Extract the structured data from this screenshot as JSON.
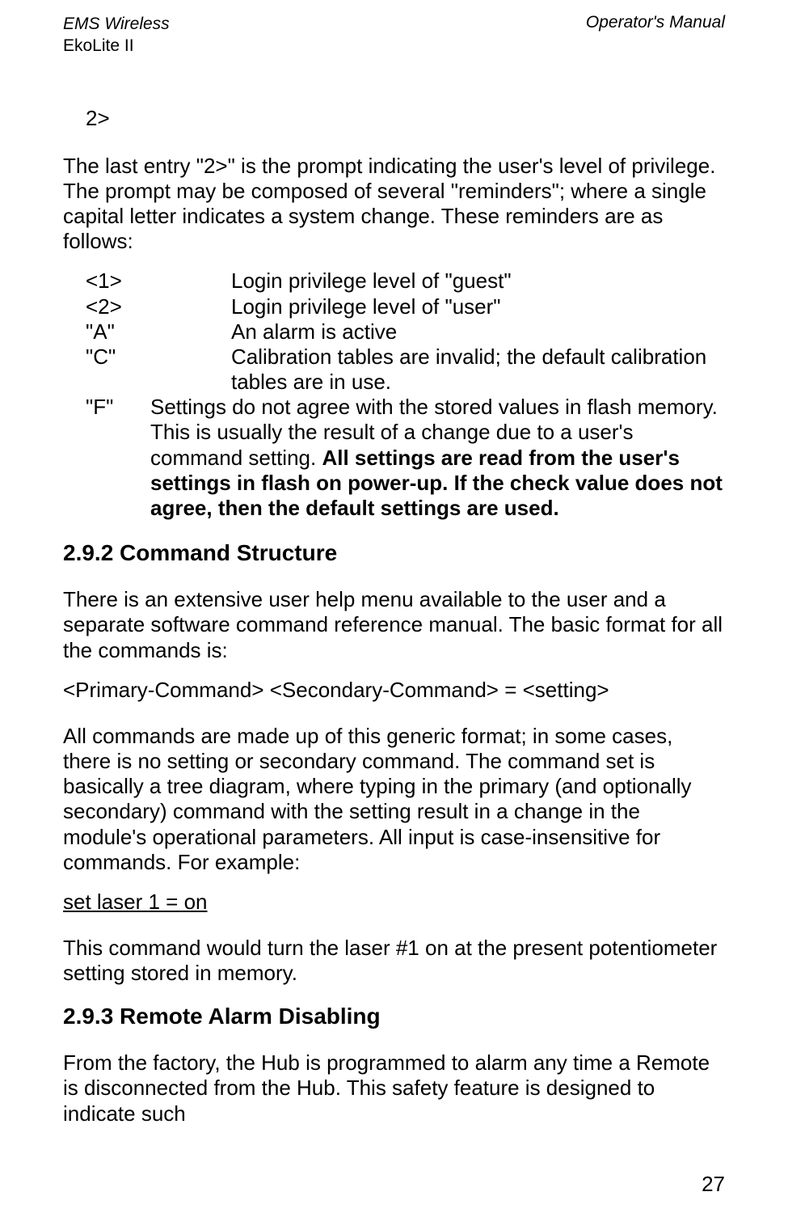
{
  "header": {
    "left_line1": "EMS Wireless",
    "left_line2": "EkoLite II",
    "right": "Operator's Manual"
  },
  "prompt": "2>",
  "para1": "The last entry \"2>\" is the prompt indicating the user's level of privilege.  The prompt may be composed of several \"reminders\"; where a single capital letter indicates a system change.  These reminders are as follows:",
  "reminders": {
    "r1": {
      "key": "<1>",
      "desc": "Login privilege level of \"guest\""
    },
    "r2": {
      "key": "<2>",
      "desc": "Login privilege level of \"user\""
    },
    "r3": {
      "key": "\"A\"",
      "desc": "An alarm is active"
    },
    "r4": {
      "key": "\"C\"",
      "desc": "Calibration tables are invalid; the default calibration tables are in use."
    },
    "r5": {
      "key": "\"F\"",
      "desc_part1": "Settings do not agree with the stored values in flash memory.  This is usually the result of a change due to a user's command setting.  ",
      "desc_bold": "All settings are read from the user's settings in flash on power-up.  If the check value does not agree, then the default settings are used."
    }
  },
  "section1": {
    "heading": "2.9.2 Command Structure",
    "para1": "There is an extensive user help menu available to the user and a separate software command reference manual.  The basic format for all the commands is:",
    "format": "<Primary-Command> <Secondary-Command> = <setting>",
    "para2": "All commands are made up of this generic format; in some cases, there is no setting or secondary command.  The command set is basically a tree diagram, where typing in the primary (and optionally secondary) command with the setting result in a change in the module's operational parameters.  All input is case-insensitive for commands.  For example:",
    "example": "set laser 1 = on",
    "para3": "This command would turn the laser #1 on at the present potentiometer setting stored in memory."
  },
  "section2": {
    "heading": "2.9.3  Remote Alarm Disabling",
    "para1": "From the factory, the Hub is programmed to alarm any time a Remote is disconnected from the Hub.  This safety feature is designed to indicate such"
  },
  "page_number": "27"
}
